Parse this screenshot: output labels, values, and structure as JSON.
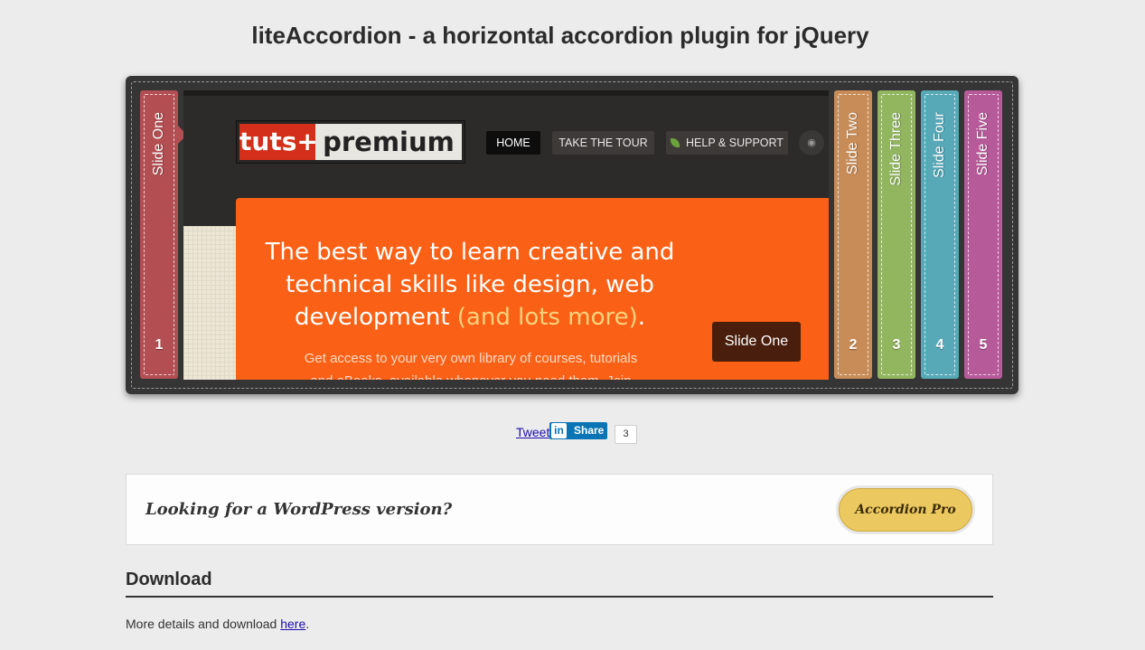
{
  "page": {
    "title": "liteAccordion - a horizontal accordion plugin for jQuery"
  },
  "accordion": {
    "spines": [
      {
        "title": "Slide One",
        "number": "1",
        "color": "#b34e52"
      },
      {
        "title": "Slide Two",
        "number": "2",
        "color": "#c88c58"
      },
      {
        "title": "Slide Three",
        "number": "3",
        "color": "#92b660"
      },
      {
        "title": "Slide Four",
        "number": "4",
        "color": "#57a9b8"
      },
      {
        "title": "Slide Five",
        "number": "5",
        "color": "#b75a9a"
      }
    ],
    "active_slide": {
      "logo_left": "tuts+",
      "logo_right": "premium",
      "nav": [
        "HOME",
        "TAKE THE TOUR",
        "HELP & SUPPORT"
      ],
      "hero_title_line1": "The best way to learn creative and",
      "hero_title_line2": "technical skills like design, web",
      "hero_title_line3a": "development",
      "hero_title_highlight": "(and lots more)",
      "hero_title_end": ".",
      "hero_sub_line1": "Get access to your very own library of courses, tutorials",
      "hero_sub_line2": "and eBooks, available whenever you need them. Join",
      "slide_button": "Slide One",
      "accent_color": "#fb6116"
    }
  },
  "social": {
    "tweet": "Tweet",
    "linkedin_logo": "in",
    "linkedin_share": "Share",
    "share_count": "3"
  },
  "promo": {
    "text": "Looking for a WordPress version?",
    "button": "Accordion Pro"
  },
  "download": {
    "heading": "Download",
    "text_prefix": "More details and download ",
    "link": "here",
    "text_suffix": "."
  }
}
